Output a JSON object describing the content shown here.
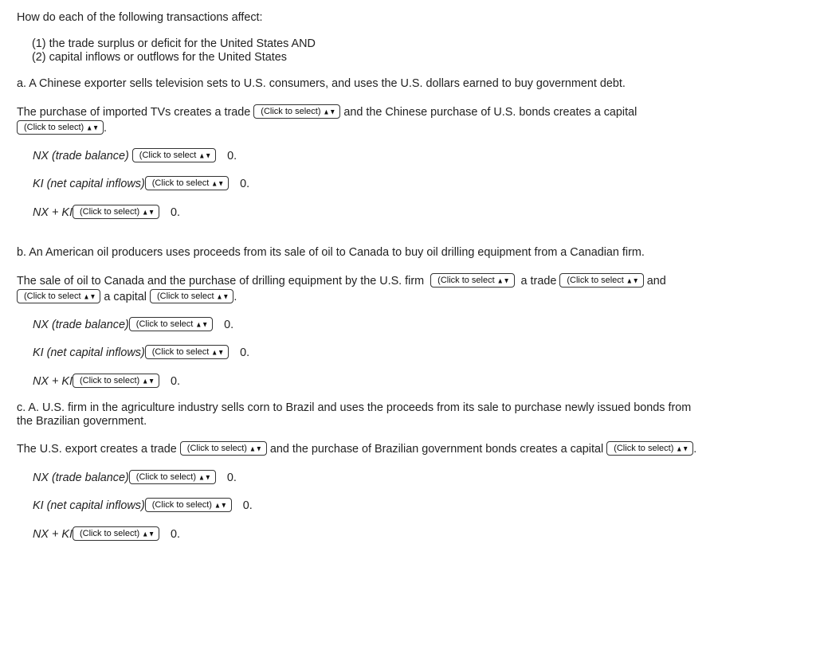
{
  "intro": {
    "question": "How do each of the following transactions affect:",
    "item1": "(1) the trade surplus or deficit for the United States AND",
    "item2": "(2) capital inflows or outflows for the United States"
  },
  "dropdown": {
    "arrow_icon": "up-down-arrows-icon"
  },
  "zero_text": "0.",
  "part_a": {
    "prompt": "a.  A Chinese exporter sells television sets to U.S. consumers, and uses the U.S. dollars earned to buy government debt.",
    "sentence_1": "The purchase of imported TVs creates a trade",
    "sentence_2": "and the Chinese purchase of U.S. bonds creates a capital",
    "sentence_end": ".",
    "select_trade": "(Click to select)",
    "select_capital": "(Click to select)",
    "nx_label": "NX (trade balance)",
    "nx_select": "(Click to select",
    "ki_label": "KI (net capital inflows)",
    "ki_select": "(Click to select",
    "sum_label": "NX + KI",
    "sum_select": "(Click to select)"
  },
  "part_b": {
    "prompt": "b.  An American oil producers uses proceeds from its sale of oil to Canada to buy oil drilling equipment from a Canadian firm.",
    "sentence_1": "The sale of oil to Canada and the purchase of drilling equipment by the U.S. firm",
    "sentence_2": "a trade",
    "sentence_3": "and",
    "sentence_4": "a capital",
    "sentence_end": ".",
    "select_1": "(Click to select",
    "select_2": "(Click to select",
    "select_3": "(Click to select",
    "select_4": "(Click to select",
    "nx_label": "NX (trade balance)",
    "nx_select": "(Click to select",
    "ki_label": "KI (net capital inflows)",
    "ki_select": "(Click to select",
    "sum_label": "NX + KI",
    "sum_select": "(Click to select)"
  },
  "part_c": {
    "prompt_line1": "c.  A. U.S. firm in the agriculture industry sells corn to Brazil and uses the proceeds from its sale to purchase newly issued bonds from",
    "prompt_line2": "the Brazilian government.",
    "sentence_1": "The U.S. export creates a trade",
    "sentence_2": "and the purchase of Brazilian government bonds creates a capital",
    "sentence_end": ".",
    "select_trade": "(Click to select)",
    "select_capital": "(Click to select)",
    "nx_label": "NX (trade balance)",
    "nx_select": "(Click to select)",
    "ki_label": "KI (net capital inflows)",
    "ki_select": "(Click to select)",
    "sum_label": "NX + KI",
    "sum_select": "(Click to select)"
  }
}
